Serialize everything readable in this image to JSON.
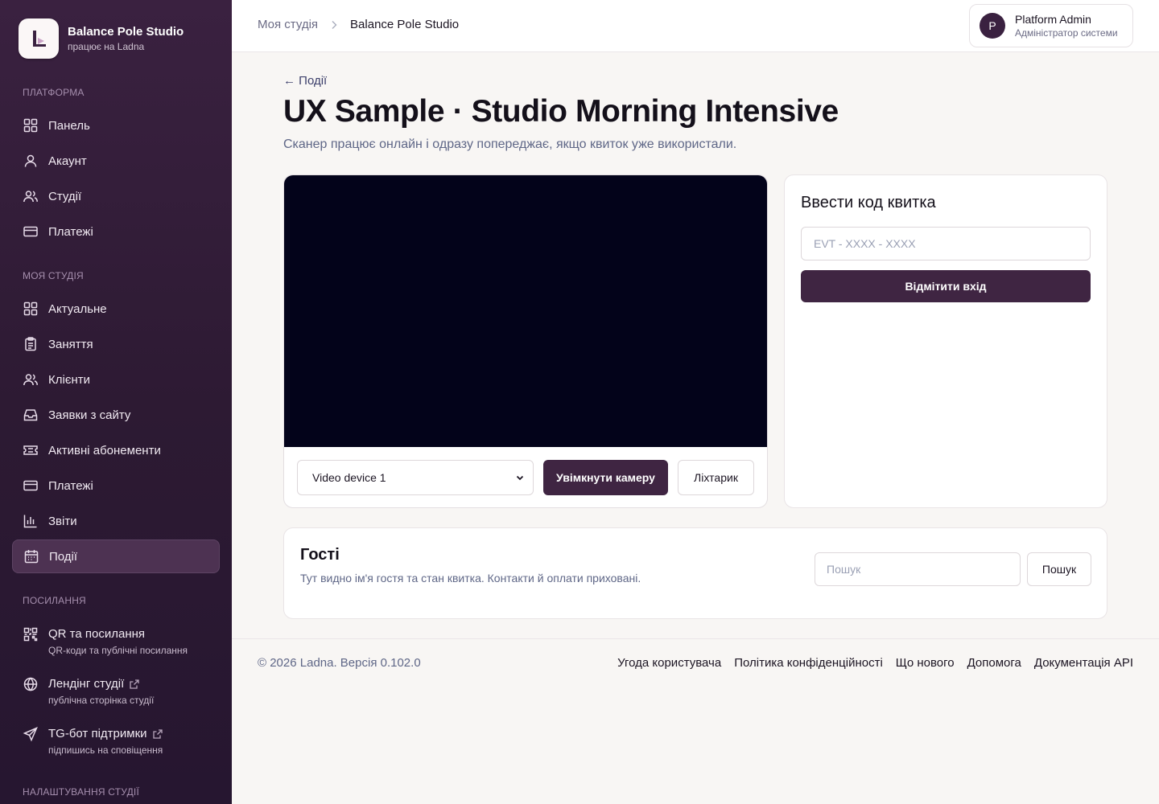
{
  "brand": {
    "name": "Balance Pole Studio",
    "sub": "працює на Ladna"
  },
  "sidebar": {
    "platform_title": "Платформа",
    "platform": [
      {
        "label": "Панель",
        "icon": "grid-icon"
      },
      {
        "label": "Акаунт",
        "icon": "user-icon"
      },
      {
        "label": "Студії",
        "icon": "users-icon"
      },
      {
        "label": "Платежі",
        "icon": "credit-card-icon"
      }
    ],
    "studio_title": "Моя студія",
    "studio": [
      {
        "label": "Актуальне",
        "icon": "grid-icon"
      },
      {
        "label": "Заняття",
        "icon": "clipboard-icon"
      },
      {
        "label": "Клієнти",
        "icon": "users-icon"
      },
      {
        "label": "Заявки з сайту",
        "icon": "inbox-icon"
      },
      {
        "label": "Активні абонементи",
        "icon": "ticket-icon"
      },
      {
        "label": "Платежі",
        "icon": "credit-card-icon"
      },
      {
        "label": "Звіти",
        "icon": "bar-chart-icon"
      },
      {
        "label": "Події",
        "icon": "calendar-icon"
      }
    ],
    "links_title": "Посилання",
    "links": [
      {
        "label": "QR та посилання",
        "sub": "QR-коди та публічні посилання"
      },
      {
        "label": "Лендінг студії",
        "sub": "публічна сторінка студії"
      },
      {
        "label": "TG-бот підтримки",
        "sub": "підпишись на сповіщення"
      }
    ],
    "settings_title": "Налаштування студії"
  },
  "header": {
    "breadcrumb_root": "Моя студія",
    "breadcrumb_current": "Balance Pole Studio",
    "user_initial": "P",
    "user_name": "Platform Admin",
    "user_role": "Адміністратор системи"
  },
  "page": {
    "back": "← Події",
    "title": "UX Sample · Studio Morning Intensive",
    "subtitle": "Сканер працює онлайн і одразу попереджає, якщо квиток уже використали."
  },
  "scanner": {
    "device": "Video device 1",
    "camera_button": "Увімкнути камеру",
    "torch_button": "Ліхтарик"
  },
  "code": {
    "title": "Ввести код квитка",
    "placeholder": "EVT - XXXX - XXXX",
    "button": "Відмітити вхід"
  },
  "guests": {
    "title": "Гості",
    "subtitle": "Тут видно ім'я гостя та стан квитка. Контакти й оплати приховані.",
    "search_placeholder": "Пошук",
    "search_button": "Пошук"
  },
  "footer": {
    "copyright": "© 2026 Ladna. Версія 0.102.0",
    "links": [
      "Угода користувача",
      "Політика конфіденційності",
      "Що нового",
      "Допомога",
      "Документація API"
    ]
  },
  "colors": {
    "sidebar": "#3a2140",
    "accent": "#3f2542",
    "video": "#03031a"
  }
}
